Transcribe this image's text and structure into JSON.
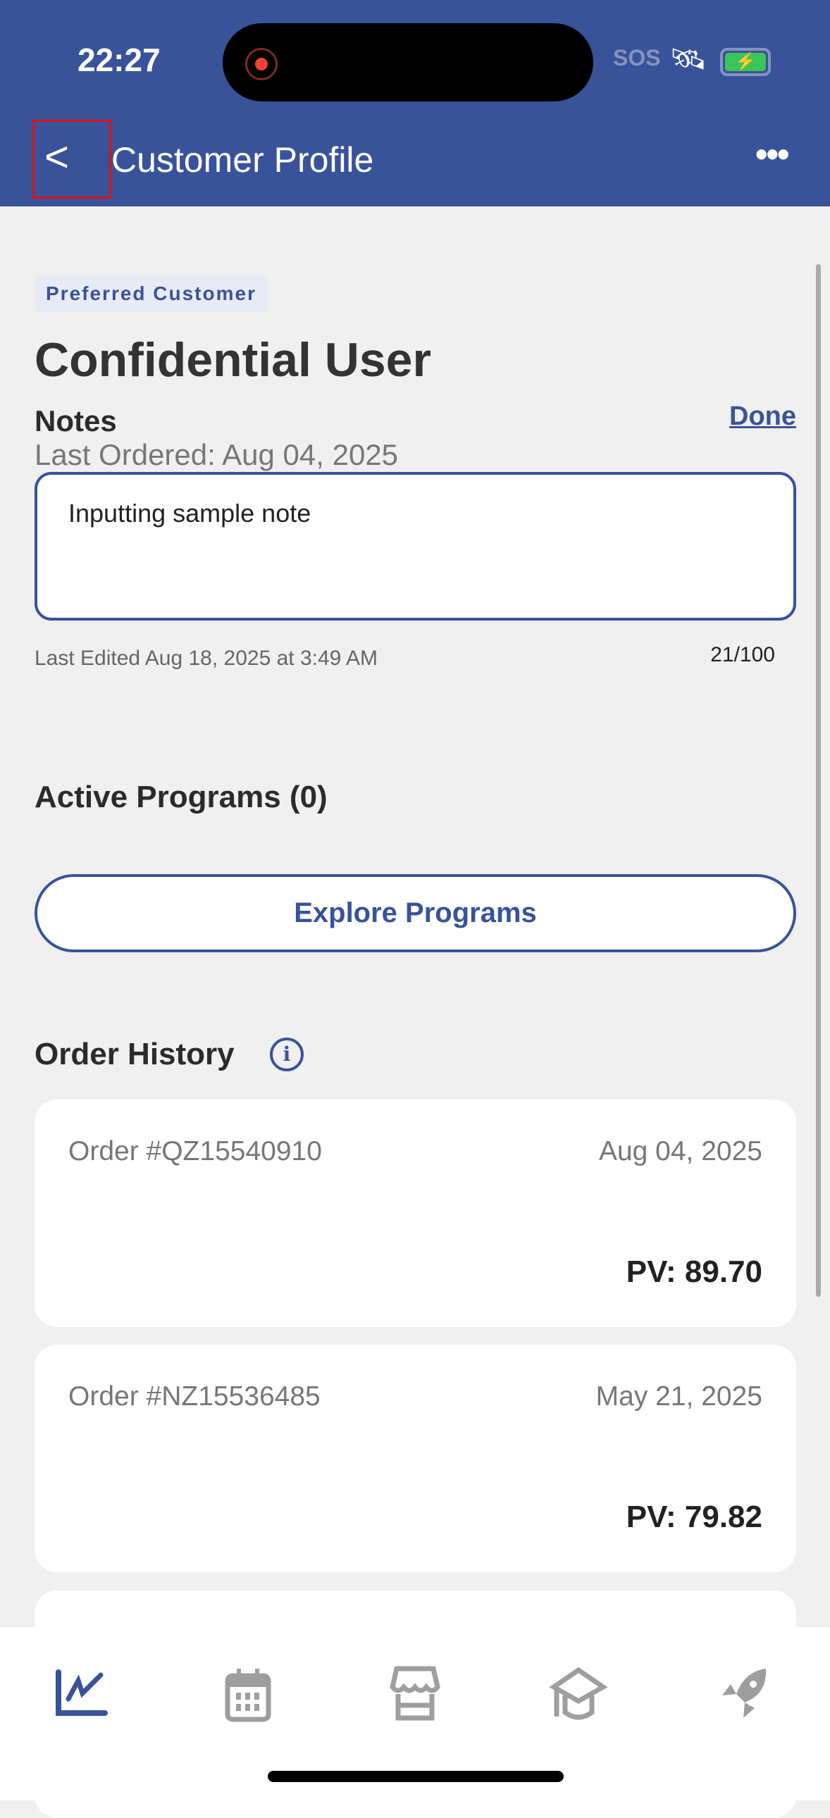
{
  "status_bar": {
    "time": "22:27",
    "sos": "SOS",
    "colors": {
      "battery": "#3ac45a",
      "recording": "#f04236"
    }
  },
  "header": {
    "title": "Customer Profile",
    "back_icon": "chevron-left-icon",
    "more_icon": "ellipsis-icon",
    "color": "#39539a"
  },
  "profile": {
    "badge": "Preferred Customer",
    "name": "Confidential User"
  },
  "notes": {
    "label": "Notes",
    "done_label": "Done",
    "last_ordered": "Last Ordered: Aug 04, 2025",
    "value": "Inputting sample note",
    "last_edited": "Last Edited  Aug 18, 2025 at 3:49 AM",
    "char_count": "21/100"
  },
  "programs": {
    "title": "Active Programs (0)",
    "explore_label": "Explore Programs"
  },
  "order_history": {
    "title": "Order History",
    "orders": [
      {
        "number": "Order #QZ15540910",
        "date": "Aug 04, 2025",
        "pv": "PV: 89.70"
      },
      {
        "number": "Order #NZ15536485",
        "date": "May 21, 2025",
        "pv": "PV: 79.82"
      }
    ]
  },
  "tab_bar": {
    "items": [
      {
        "icon": "chart-icon",
        "active": true
      },
      {
        "icon": "calendar-icon"
      },
      {
        "icon": "store-icon"
      },
      {
        "icon": "graduation-cap-icon"
      },
      {
        "icon": "rocket-icon"
      }
    ]
  }
}
